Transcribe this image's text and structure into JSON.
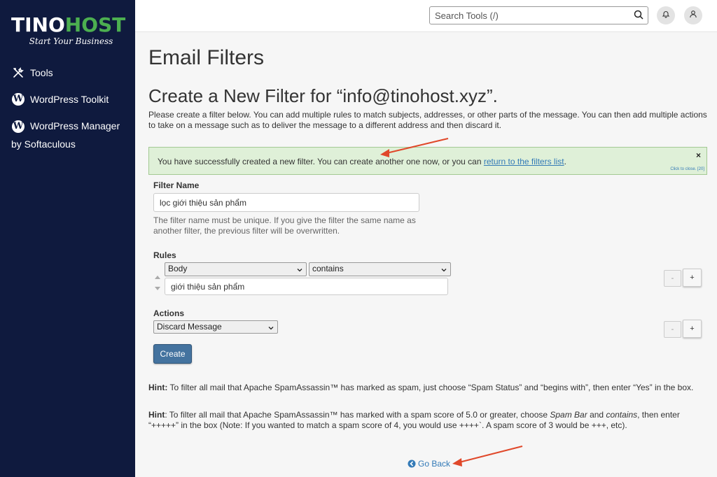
{
  "brand": {
    "name_part1": "TINO",
    "name_part2": "HOST",
    "tagline": "Start Your Business"
  },
  "sidebar": {
    "items": [
      {
        "label": "Tools",
        "icon": "tools-icon"
      },
      {
        "label": "WordPress Toolkit",
        "icon": "wordpress-icon"
      },
      {
        "label": "WordPress Manager",
        "label2": "by Softaculous",
        "icon": "wordpress-icon"
      }
    ]
  },
  "topbar": {
    "search_placeholder": "Search Tools (/)"
  },
  "page": {
    "title": "Email Filters",
    "subtitle": "Create a New Filter for “info@tinohost.xyz”.",
    "description": "Please create a filter below. You can add multiple rules to match subjects, addresses, or other parts of the message. You can then add multiple actions to take on a message such as to deliver the message to a different address and then discard it."
  },
  "alert": {
    "text": "You have successfully created a new filter. You can create another one now, or you can ",
    "link": "return to the filters list",
    "text_end": ".",
    "close": "×",
    "close_hint": "Click to close. [20]"
  },
  "form": {
    "filter_name_label": "Filter Name",
    "filter_name_value": "lọc giới thiệu sản phẩm",
    "filter_name_help": "The filter name must be unique. If you give the filter the same name as another filter, the previous filter will be overwritten.",
    "rules_label": "Rules",
    "rule_field": "Body",
    "rule_operator": "contains",
    "rule_value": "giới thiệu sản phẩm",
    "actions_label": "Actions",
    "action_value": "Discard Message",
    "minus": "-",
    "plus": "+",
    "create_label": "Create"
  },
  "hints": {
    "hint1_label": "Hint:",
    "hint1_text": " To filter all mail that Apache SpamAssassin™ has marked as spam, just choose “Spam Status” and “begins with”, then enter “Yes” in the box.",
    "hint2_label": "Hint",
    "hint2_a": ": To filter all mail that Apache SpamAssassin™ has marked with a spam score of 5.0 or greater, choose ",
    "hint2_em1": "Spam Bar",
    "hint2_b": " and ",
    "hint2_em2": "contains",
    "hint2_c": ", then enter “+++++” in the box (Note: If you wanted to match a spam score of 4, you would use ++++`. A spam score of 3 would be +++, etc)."
  },
  "footer": {
    "go_back": "Go Back"
  },
  "colors": {
    "sidebar": "#0f1a3e",
    "brand_green": "#4caf50",
    "link": "#337ab7",
    "alert_bg": "#dff0d8",
    "annotation_arrow": "#e0482a"
  }
}
